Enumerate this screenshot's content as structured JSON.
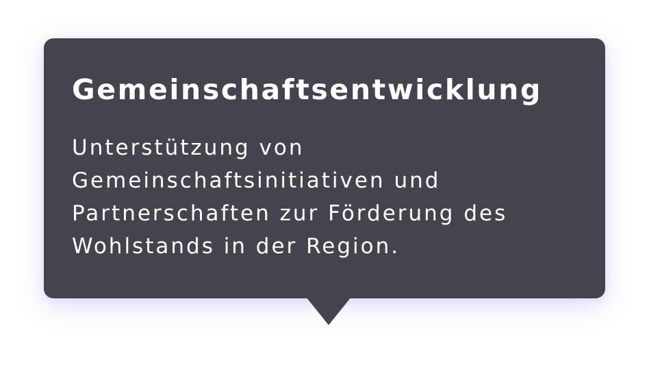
{
  "tooltip": {
    "title": "Gemeinschaftsentwicklung",
    "body": "Unterstützung von Gemeinschaftsinitiativen und Partnerschaften zur Förderung des Wohlstands in der Region.",
    "background_color": "#45444e",
    "text_color": "#ffffff"
  }
}
